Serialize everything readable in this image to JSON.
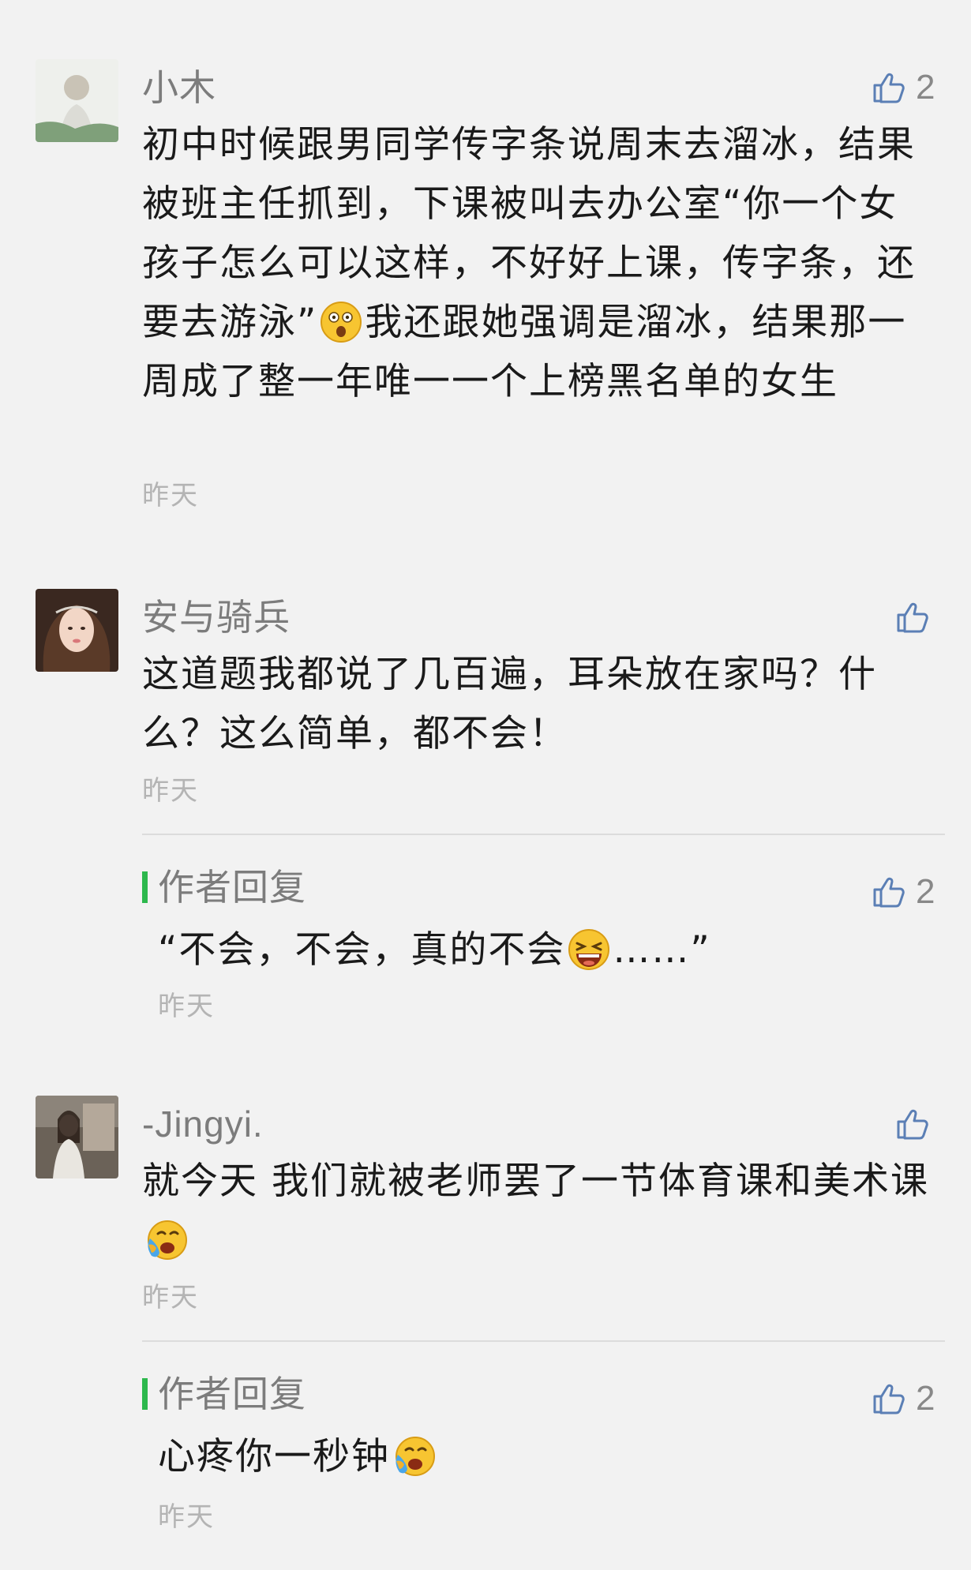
{
  "comments": [
    {
      "name": "小木",
      "likes": "2",
      "text_a": "初中时候跟男同学传字条说周末去溜冰，结果被班主任抓到，下课被叫去办公室“你一个女孩子怎么可以这样，不好好上课，传字条，还要去游泳”",
      "emoji": "shocked-face-emoji",
      "text_b": "我还跟她强调是溜冰，结果那一周成了整一年唯一一个上榜黑名单的女生",
      "time": "昨天"
    },
    {
      "name": "安与骑兵",
      "likes": "",
      "text": "这道题我都说了几百遍，耳朵放在家吗？什么？这么简单，都不会！",
      "time": "昨天",
      "reply": {
        "title": "作者回复",
        "likes": "2",
        "text_a": "“不会，不会，真的不会",
        "emoji": "laughing-crying-face-emoji",
        "text_b": "……”",
        "time": "昨天"
      }
    },
    {
      "name": "-Jingyi.",
      "likes": "",
      "text": "就今天 我们就被老师罢了一节体育课和美术课",
      "emoji": "loudly-crying-face-emoji",
      "time": "昨天",
      "reply": {
        "title": "作者回复",
        "likes": "2",
        "text": "心疼你一秒钟",
        "emoji": "loudly-crying-face-emoji",
        "time": "昨天"
      }
    }
  ],
  "colors": {
    "background": "#f2f2f2",
    "accent_bar": "#2db84d",
    "name_gray": "#7c7c7c",
    "time_gray": "#b4b4b4",
    "like_blue": "#5b7fb5"
  }
}
